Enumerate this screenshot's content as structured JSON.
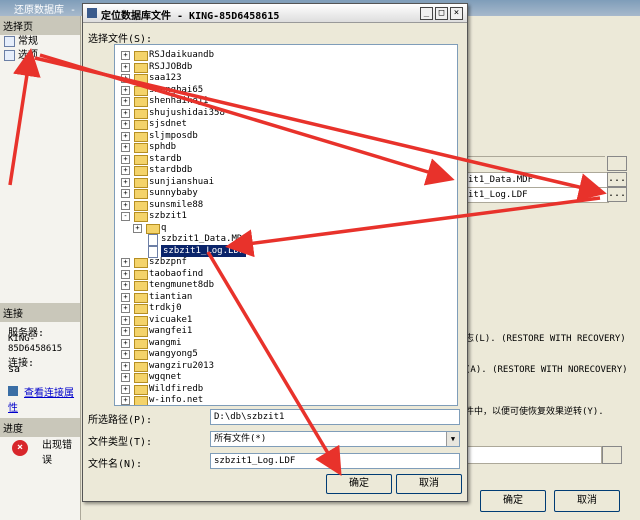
{
  "background_window": {
    "title": "还原数据库 - s",
    "select_page_header": "选择页",
    "pages": [
      {
        "label": "常规"
      },
      {
        "label": "选项"
      }
    ],
    "connection_header": "连接",
    "server_label": "服务器:",
    "server_value": "KING-85D6458615",
    "connection_label": "连接:",
    "connection_value": "sa",
    "view_connection_link": "查看连接属性",
    "progress_header": "进度",
    "progress_status": "出现错误",
    "file_rows": [
      {
        "value": "it1_Data.MDF"
      },
      {
        "value": "it1_Log.LDF"
      }
    ],
    "browse_label": "...",
    "option_texts": [
      {
        "text": "志(L). (RESTORE WITH RECOVERY)"
      },
      {
        "text": "(A). (RESTORE WITH NORECOVERY)"
      },
      {
        "text": "件中，以便可使恢复效果逆转(Y)."
      }
    ],
    "ok_button": "确定",
    "cancel_button": "取消"
  },
  "dialog": {
    "title": "定位数据库文件 - KING-85D6458615",
    "select_file_label": "选择文件(S):",
    "tree": [
      {
        "label": "RSJdaikuandb",
        "type": "folder",
        "expander": "+",
        "indent": 0
      },
      {
        "label": "RSJJOBdb",
        "type": "folder",
        "expander": "+",
        "indent": 0
      },
      {
        "label": "saa123",
        "type": "folder",
        "expander": "+",
        "indent": 0
      },
      {
        "label": "shanghai65",
        "type": "folder",
        "expander": "+",
        "indent": 0
      },
      {
        "label": "shenhaikeji",
        "type": "folder",
        "expander": "+",
        "indent": 0
      },
      {
        "label": "shujushidai358",
        "type": "folder",
        "expander": "+",
        "indent": 0
      },
      {
        "label": "sjsdnet",
        "type": "folder",
        "expander": "+",
        "indent": 0
      },
      {
        "label": "sljmposdb",
        "type": "folder",
        "expander": "+",
        "indent": 0
      },
      {
        "label": "sphdb",
        "type": "folder",
        "expander": "+",
        "indent": 0
      },
      {
        "label": "stardb",
        "type": "folder",
        "expander": "+",
        "indent": 0
      },
      {
        "label": "stardbdb",
        "type": "folder",
        "expander": "+",
        "indent": 0
      },
      {
        "label": "sunjianshuai",
        "type": "folder",
        "expander": "+",
        "indent": 0
      },
      {
        "label": "sunnybaby",
        "type": "folder",
        "expander": "+",
        "indent": 0
      },
      {
        "label": "sunsmile88",
        "type": "folder",
        "expander": "+",
        "indent": 0
      },
      {
        "label": "szbzit1",
        "type": "folder",
        "expander": "-",
        "indent": 0
      },
      {
        "label": "q",
        "type": "folder",
        "expander": "+",
        "indent": 1
      },
      {
        "label": "szbzit1_Data.MDF",
        "type": "file",
        "expander": "",
        "indent": 1
      },
      {
        "label": "szbzit1_Log.LDF",
        "type": "file",
        "expander": "",
        "indent": 1,
        "selected": true
      },
      {
        "label": "szbzpnf",
        "type": "folder",
        "expander": "+",
        "indent": 0
      },
      {
        "label": "taobaofind",
        "type": "folder",
        "expander": "+",
        "indent": 0
      },
      {
        "label": "tengmunet8db",
        "type": "folder",
        "expander": "+",
        "indent": 0
      },
      {
        "label": "tiantian",
        "type": "folder",
        "expander": "+",
        "indent": 0
      },
      {
        "label": "trdkj0",
        "type": "folder",
        "expander": "+",
        "indent": 0
      },
      {
        "label": "vicuake1",
        "type": "folder",
        "expander": "+",
        "indent": 0
      },
      {
        "label": "wangfei1",
        "type": "folder",
        "expander": "+",
        "indent": 0
      },
      {
        "label": "wangmi",
        "type": "folder",
        "expander": "+",
        "indent": 0
      },
      {
        "label": "wangyong5",
        "type": "folder",
        "expander": "+",
        "indent": 0
      },
      {
        "label": "wangziru2013",
        "type": "folder",
        "expander": "+",
        "indent": 0
      },
      {
        "label": "wgqnet",
        "type": "folder",
        "expander": "+",
        "indent": 0
      },
      {
        "label": "Wildfiredb",
        "type": "folder",
        "expander": "+",
        "indent": 0
      },
      {
        "label": "w-info.net",
        "type": "folder",
        "expander": "+",
        "indent": 0
      }
    ],
    "selected_path_label": "所选路径(P):",
    "selected_path_value": "D:\\db\\szbzit1",
    "file_type_label": "文件类型(T):",
    "file_type_value": "所有文件(*)",
    "file_name_label": "文件名(N):",
    "file_name_value": "szbzit1_Log.LDF",
    "ok_button": "确定",
    "cancel_button": "取消"
  },
  "colors": {
    "annotation_arrow": "#e8322b",
    "selection": "#0a246a"
  }
}
